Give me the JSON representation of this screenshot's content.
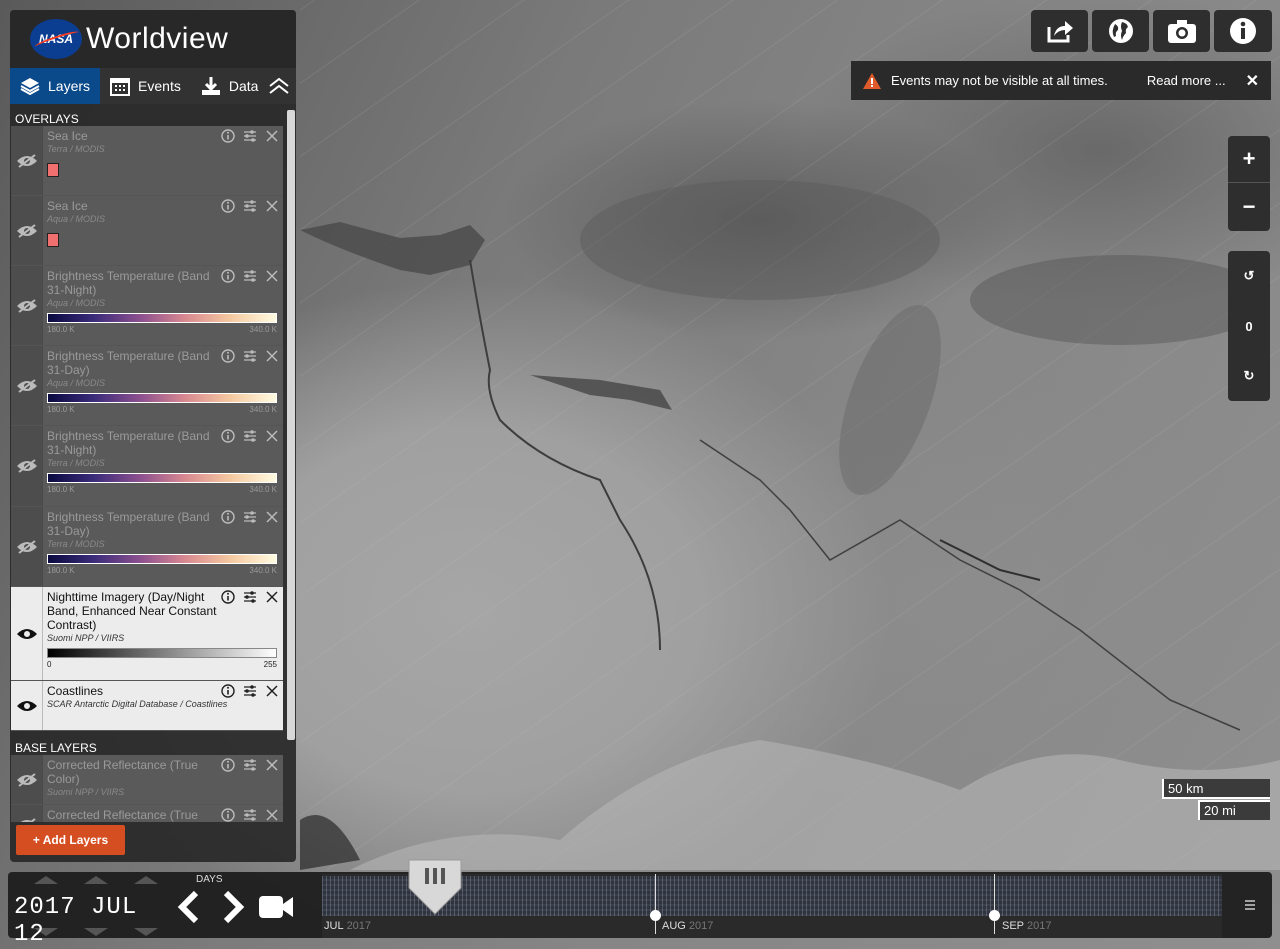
{
  "brand": {
    "name": "Worldview",
    "logo_text": "NASA"
  },
  "tabs": [
    {
      "label": "Layers",
      "icon": "layers-icon"
    },
    {
      "label": "Events",
      "icon": "calendar-icon"
    },
    {
      "label": "Data",
      "icon": "download-icon"
    }
  ],
  "overlays_title": "OVERLAYS",
  "base_title": "BASE LAYERS",
  "overlays": [
    {
      "title": "Sea Ice",
      "sub": "Terra / MODIS",
      "legend": "swatch",
      "enabled": false
    },
    {
      "title": "Sea Ice",
      "sub": "Aqua / MODIS",
      "legend": "swatch",
      "enabled": false
    },
    {
      "title": "Brightness Temperature (Band 31-Night)",
      "sub": "Aqua / MODIS",
      "legend": "temp",
      "min": "180.0 K",
      "max": "340.0 K",
      "enabled": false
    },
    {
      "title": "Brightness Temperature (Band 31-Day)",
      "sub": "Aqua / MODIS",
      "legend": "temp",
      "min": "180.0 K",
      "max": "340.0 K",
      "enabled": false
    },
    {
      "title": "Brightness Temperature (Band 31-Night)",
      "sub": "Terra / MODIS",
      "legend": "temp",
      "min": "180.0 K",
      "max": "340.0 K",
      "enabled": false
    },
    {
      "title": "Brightness Temperature (Band 31-Day)",
      "sub": "Terra / MODIS",
      "legend": "temp",
      "min": "180.0 K",
      "max": "340.0 K",
      "enabled": false
    },
    {
      "title": "Nighttime Imagery (Day/Night Band, Enhanced Near Constant Contrast)",
      "sub": "Suomi NPP / VIIRS",
      "legend": "gray",
      "min": "0",
      "max": "255",
      "enabled": true
    },
    {
      "title": "Coastlines",
      "sub": "SCAR Antarctic Digital Database / Coastlines",
      "legend": "none",
      "enabled": true
    }
  ],
  "base_layers": [
    {
      "title": "Corrected Reflectance (True Color)",
      "sub": "Suomi NPP / VIIRS",
      "enabled": false
    },
    {
      "title": "Corrected Reflectance (True",
      "sub": "",
      "enabled": false
    }
  ],
  "add_layers_label": "+ Add Layers",
  "alert": {
    "text": "Events may not be visible at all times.",
    "more": "Read more ..."
  },
  "toolbar": [
    {
      "icon": "share-icon"
    },
    {
      "icon": "globe-icon"
    },
    {
      "icon": "camera-icon"
    },
    {
      "icon": "info-icon"
    }
  ],
  "zoom": {
    "in": "+",
    "out": "−"
  },
  "rotation": {
    "ccw": "↺",
    "value": "0",
    "cw": "↻"
  },
  "scale": {
    "km": "50 km",
    "mi": "20 mi"
  },
  "timeline": {
    "date": "2017 JUL 12",
    "interval": "DAYS",
    "months": [
      {
        "label": "JUL",
        "year": "2017"
      },
      {
        "label": "AUG",
        "year": "2017"
      },
      {
        "label": "SEP",
        "year": "2017"
      }
    ]
  },
  "colors": {
    "accent": "#0b4a8a",
    "add_button": "#d54e21",
    "warning": "#e05a2a"
  }
}
